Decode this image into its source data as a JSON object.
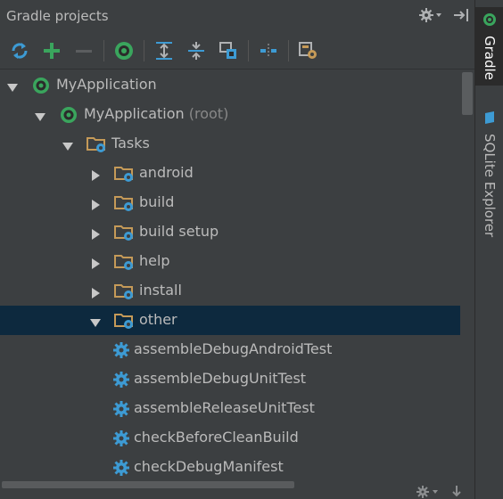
{
  "panel": {
    "title": "Gradle projects"
  },
  "toolbar": {
    "buttons": [
      {
        "icon": "refresh-icon"
      },
      {
        "icon": "add-icon"
      },
      {
        "icon": "remove-icon"
      },
      {
        "icon": "gradle-execute-icon"
      },
      {
        "icon": "expand-all-icon"
      },
      {
        "icon": "collapse-all-icon"
      },
      {
        "icon": "attach-project-icon"
      },
      {
        "icon": "toggle-offline-icon"
      },
      {
        "icon": "settings-icon"
      }
    ]
  },
  "tree": {
    "selected_index": 7,
    "items": [
      {
        "label": "MyApplication",
        "suffix": "",
        "icon": "gradle-icon",
        "expanded": true,
        "level": 0
      },
      {
        "label": "MyApplication",
        "suffix": "(root)",
        "icon": "gradle-icon",
        "expanded": true,
        "level": 1
      },
      {
        "label": "Tasks",
        "suffix": "",
        "icon": "task-folder-icon",
        "expanded": true,
        "level": 2
      },
      {
        "label": "android",
        "suffix": "",
        "icon": "task-folder-icon",
        "expanded": false,
        "level": 3
      },
      {
        "label": "build",
        "suffix": "",
        "icon": "task-folder-icon",
        "expanded": false,
        "level": 3
      },
      {
        "label": "build setup",
        "suffix": "",
        "icon": "task-folder-icon",
        "expanded": false,
        "level": 3
      },
      {
        "label": "help",
        "suffix": "",
        "icon": "task-folder-icon",
        "expanded": false,
        "level": 3
      },
      {
        "label": "install",
        "suffix": "",
        "icon": "task-folder-icon",
        "expanded": false,
        "level": 3
      },
      {
        "label": "other",
        "suffix": "",
        "icon": "task-folder-icon",
        "expanded": true,
        "level": 3
      },
      {
        "label": "assembleDebugAndroidTest",
        "suffix": "",
        "icon": "gear-icon",
        "level": 4
      },
      {
        "label": "assembleDebugUnitTest",
        "suffix": "",
        "icon": "gear-icon",
        "level": 4
      },
      {
        "label": "assembleReleaseUnitTest",
        "suffix": "",
        "icon": "gear-icon",
        "level": 4
      },
      {
        "label": "checkBeforeCleanBuild",
        "suffix": "",
        "icon": "gear-icon",
        "level": 4
      },
      {
        "label": "checkDebugManifest",
        "suffix": "",
        "icon": "gear-icon",
        "level": 4
      }
    ]
  },
  "sidebar": {
    "tabs": [
      {
        "label": "Gradle",
        "icon": "gradle-icon",
        "active": true
      },
      {
        "label": "SQLite Explorer",
        "icon": "database-icon",
        "active": false
      }
    ]
  },
  "colors": {
    "background": "#3c3f41",
    "selection": "#0d293e",
    "text": "#bbbbbb",
    "gradle_green": "#3aa55d",
    "folder": "#c59a58",
    "gear_blue": "#3d9bd4"
  }
}
